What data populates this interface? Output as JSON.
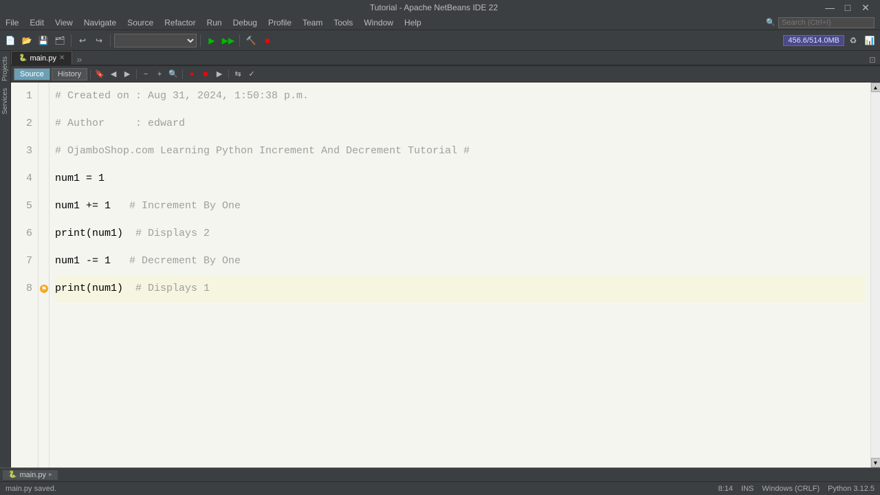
{
  "titlebar": {
    "title": "Tutorial - Apache NetBeans IDE 22",
    "min": "—",
    "max": "□",
    "close": "✕"
  },
  "menubar": {
    "items": [
      "File",
      "Edit",
      "View",
      "Navigate",
      "Source",
      "Refactor",
      "Run",
      "Debug",
      "Profile",
      "Team",
      "Tools",
      "Window",
      "Help"
    ]
  },
  "toolbar": {
    "memory": "456.6/514.0MB",
    "project_placeholder": ""
  },
  "tabs": {
    "file_tab": "main.py",
    "source_tab": "Source",
    "history_tab": "History"
  },
  "code": {
    "lines": [
      {
        "number": "1",
        "content": "# Created on : Aug 31, 2024, 1:50:38 p.m.",
        "type": "comment",
        "highlighted": false
      },
      {
        "number": "2",
        "content": "# Author     : edward",
        "type": "comment",
        "highlighted": false
      },
      {
        "number": "3",
        "content": "# OjamboShop.com Learning Python Increment And Decrement Tutorial #",
        "type": "comment",
        "highlighted": false
      },
      {
        "number": "4",
        "content": "num1 = 1",
        "type": "normal",
        "highlighted": false
      },
      {
        "number": "5",
        "content": "num1 += 1   # Increment By One",
        "type": "mixed",
        "highlighted": false
      },
      {
        "number": "6",
        "content": "print(num1)  # Displays 2",
        "type": "mixed",
        "highlighted": false
      },
      {
        "number": "7",
        "content": "num1 -= 1   # Decrement By One",
        "type": "mixed",
        "highlighted": false
      },
      {
        "number": "8",
        "content": "print(num1)  # Displays 1",
        "type": "mixed",
        "highlighted": true
      }
    ]
  },
  "statusbar": {
    "saved_msg": "main.py saved.",
    "cursor_pos": "8:14",
    "encoding": "INS",
    "line_ending": "Windows (CRLF)",
    "python_version": "Python 3.12.5"
  },
  "bottom_tab": {
    "label": "main.py"
  }
}
